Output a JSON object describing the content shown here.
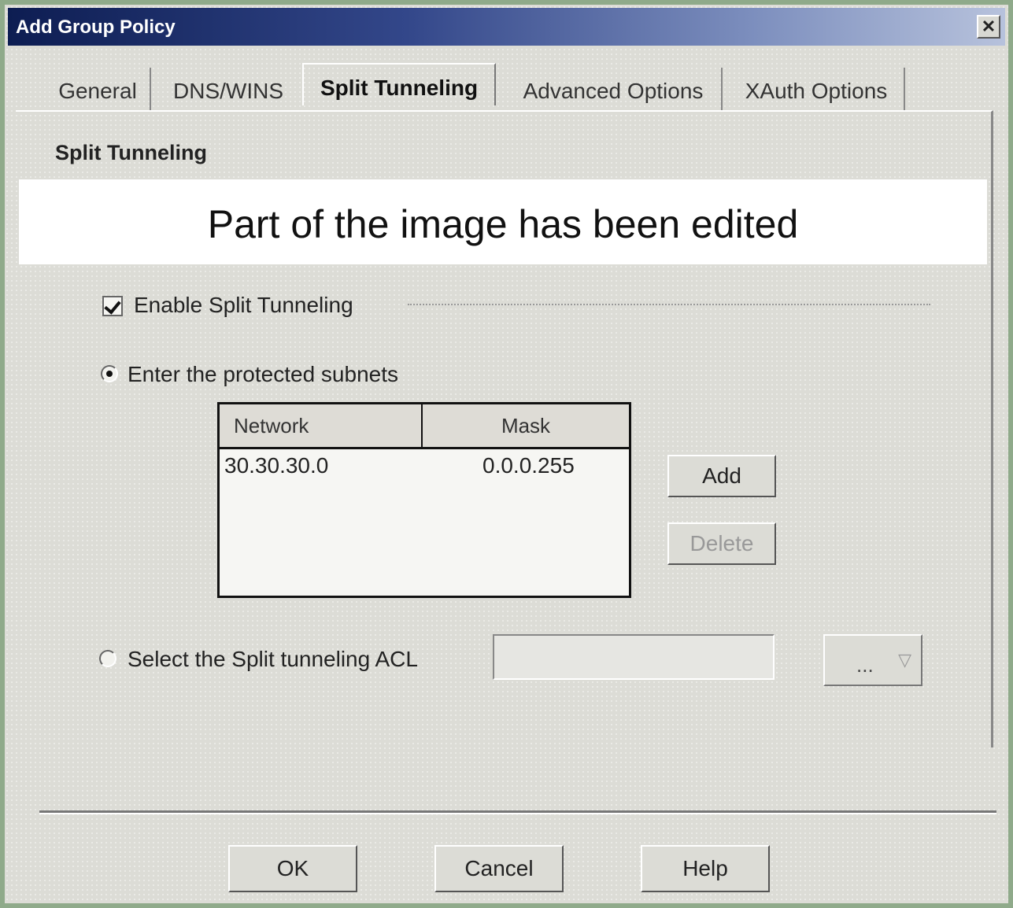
{
  "window": {
    "title": "Add Group Policy",
    "close_label": "✕"
  },
  "tabs": [
    {
      "label": "General"
    },
    {
      "label": "DNS/WINS"
    },
    {
      "label": "Split Tunneling"
    },
    {
      "label": "Advanced Options"
    },
    {
      "label": "XAuth Options"
    }
  ],
  "active_tab": "Split Tunneling",
  "section": {
    "title": "Split Tunneling"
  },
  "edit_banner": "Part of the image has been edited",
  "enable_split": {
    "label": "Enable Split Tunneling",
    "checked": true
  },
  "option_subnets": {
    "label": "Enter the protected subnets",
    "selected": true
  },
  "subnet_table": {
    "columns": [
      "Network",
      "Mask"
    ],
    "rows": [
      {
        "network": "30.30.30.0",
        "mask": "0.0.0.255"
      }
    ]
  },
  "buttons": {
    "add": "Add",
    "delete": "Delete",
    "ok": "OK",
    "cancel": "Cancel",
    "help": "Help"
  },
  "option_acl": {
    "label": "Select the Split tunneling ACL",
    "selected": false,
    "value": "",
    "dropdown_label": "...",
    "dropdown_icon": "chevron-down-icon"
  }
}
